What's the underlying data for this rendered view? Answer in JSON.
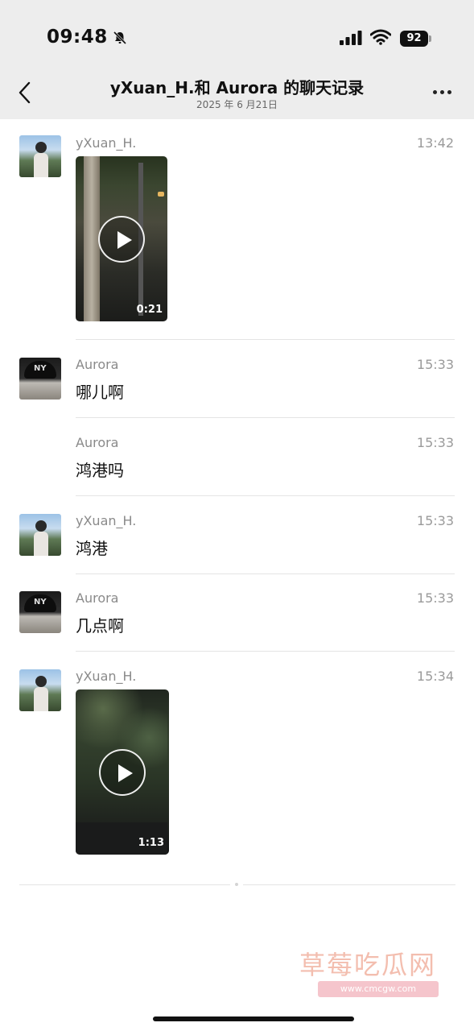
{
  "status_bar": {
    "time": "09:48",
    "battery": "92",
    "icons": [
      "bell-slash-icon",
      "signal-icon",
      "wifi-icon",
      "battery-icon"
    ]
  },
  "header": {
    "title": "yXuan_H.和 Aurora 的聊天记录",
    "subtitle": "2025 年 6 月21日",
    "back_icon": "chevron-left-icon",
    "more_icon": "ellipsis-icon"
  },
  "messages": [
    {
      "sender": "yXuan_H.",
      "time": "13:42",
      "type": "video",
      "duration": "0:21"
    },
    {
      "sender": "Aurora",
      "time": "15:33",
      "type": "text",
      "text": "哪儿啊"
    },
    {
      "sender": "Aurora",
      "time": "15:33",
      "type": "text",
      "text": "鸿港吗"
    },
    {
      "sender": "yXuan_H.",
      "time": "15:33",
      "type": "text",
      "text": "鸿港"
    },
    {
      "sender": "Aurora",
      "time": "15:33",
      "type": "text",
      "text": "几点啊"
    },
    {
      "sender": "yXuan_H.",
      "time": "15:34",
      "type": "video",
      "duration": "1:13"
    }
  ],
  "watermark": {
    "text": "草莓吃瓜网",
    "url": "www.cmcgw.com"
  },
  "colors": {
    "header_bg": "#ededed",
    "meta_text": "#8a8a8a",
    "divider": "#e4e4e4"
  }
}
